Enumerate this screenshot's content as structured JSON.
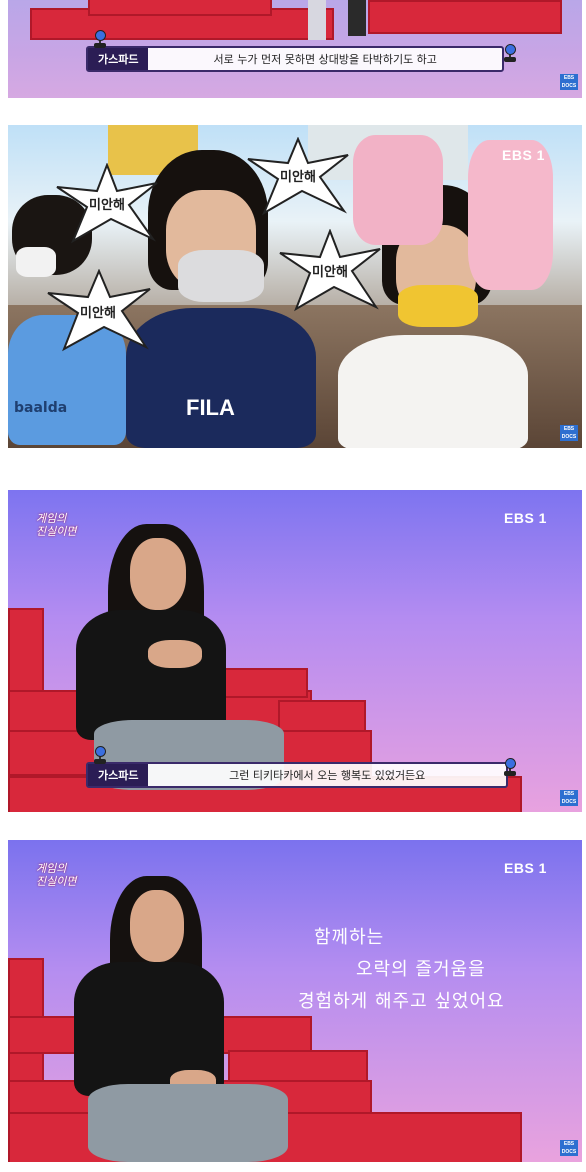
{
  "panels": [
    {
      "id": "panel-1",
      "subtitle": {
        "speaker": "가스파드",
        "line": "서로 누가 먼저 못하면 상대방을 타박하기도 하고"
      },
      "watermark": "EBS DOCS"
    },
    {
      "id": "panel-2",
      "broadcaster": "EBS 1",
      "stickers": [
        "미안해",
        "미안해",
        "미안해",
        "미안해"
      ],
      "shirt_logo": "FILA",
      "shirt_text": "baalda",
      "watermark": "EBS DOCS"
    },
    {
      "id": "panel-3",
      "broadcaster": "EBS 1",
      "subtitle": {
        "speaker": "가스파드",
        "line": "그런 티키타카에서 오는 행복도 있었거든요"
      },
      "watermark": "EBS DOCS"
    },
    {
      "id": "panel-4",
      "broadcaster": "EBS 1",
      "caption_lines": [
        "함께하는",
        "오락의 즐거움을",
        "경험하게 해주고 싶었어요"
      ],
      "watermark": "EBS DOCS"
    }
  ]
}
